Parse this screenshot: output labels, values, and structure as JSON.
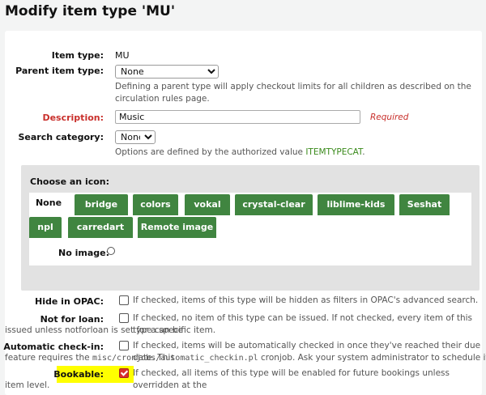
{
  "title": "Modify item type 'MU'",
  "fields": {
    "item_type": {
      "label": "Item type:",
      "value": "MU"
    },
    "parent_item_type": {
      "label": "Parent item type:",
      "selected": "None",
      "help": "Defining a parent type will apply checkout limits for all children as described on the circulation rules page."
    },
    "description": {
      "label": "Description:",
      "value": "Music",
      "required_text": "Required"
    },
    "search_category": {
      "label": "Search category:",
      "selected": "None",
      "help_prefix": "Options are defined by the authorized value ",
      "help_link": "ITEMTYPECAT",
      "help_suffix": "."
    }
  },
  "icons": {
    "title": "Choose an icon:",
    "tabs": [
      "None",
      "bridge",
      "colors",
      "vokal",
      "crystal-clear",
      "liblime-kids",
      "Seshat",
      "npl",
      "carredart",
      "Remote image"
    ],
    "active_tab": "None",
    "no_image_label": "No image:"
  },
  "options": {
    "hide_in_opac": {
      "label": "Hide in OPAC:",
      "help": "If checked, items of this type will be hidden as filters in OPAC's advanced search.",
      "checked": false
    },
    "not_for_loan": {
      "label": "Not for loan:",
      "help_line1": "If checked, no item of this type can be issued. If not checked, every item of this type can be",
      "help_line2": "issued unless notforloan is set for a specific item.",
      "checked": false
    },
    "automatic_checkin": {
      "label": "Automatic check-in:",
      "help_line1": "If checked, items will be automatically checked in once they've reached their due date. This",
      "help_line2_prefix": "feature requires the ",
      "help_line2_code": "misc/cronjobs/automatic_checkin.pl",
      "help_line2_suffix": " cronjob. Ask your system administrator to schedule it.",
      "checked": false
    },
    "bookable": {
      "label": "Bookable:",
      "help_line1": "If checked, all items of this type will be enabled for future bookings unless overridden at the",
      "help_line2": "item level.",
      "checked": true
    }
  },
  "colors": {
    "accent_green": "#408540",
    "required_red": "#c9302c",
    "highlight": "#ffff00"
  }
}
